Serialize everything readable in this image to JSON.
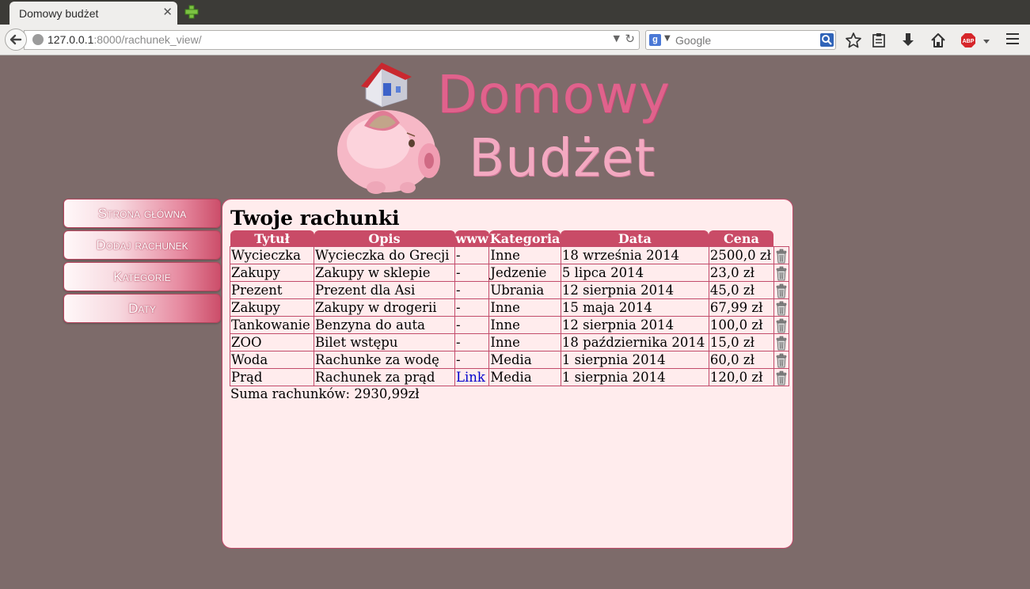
{
  "browser": {
    "tab_title": "Domowy budżet",
    "tab_close": "✕",
    "url_host": "127.0.0.1",
    "url_rest": ":8000/rachunek_view/",
    "search_placeholder": "Google",
    "search_engine_letter": "g"
  },
  "logo": {
    "line1": "Domowy",
    "line2": "Budżet"
  },
  "menu": [
    {
      "label": "Strona główna"
    },
    {
      "label": "Dodaj rachunek"
    },
    {
      "label": "Kategorie"
    },
    {
      "label": "Daty"
    }
  ],
  "content": {
    "heading": "Twoje rachunki",
    "headers": [
      "Tytuł",
      "Opis",
      "www",
      "Kategoria",
      "Data",
      "Cena"
    ],
    "rows": [
      {
        "title": "Wycieczka",
        "desc": "Wycieczka do Grecji",
        "www": "-",
        "category": "Inne",
        "date": "18 września 2014",
        "price": "2500,0 zł"
      },
      {
        "title": "Zakupy",
        "desc": "Zakupy w sklepie",
        "www": "-",
        "category": "Jedzenie",
        "date": "5 lipca 2014",
        "price": "23,0 zł"
      },
      {
        "title": "Prezent",
        "desc": "Prezent dla Asi",
        "www": "-",
        "category": "Ubrania",
        "date": "12 sierpnia 2014",
        "price": "45,0 zł"
      },
      {
        "title": "Zakupy",
        "desc": "Zakupy w drogerii",
        "www": "-",
        "category": "Inne",
        "date": "15 maja 2014",
        "price": "67,99 zł"
      },
      {
        "title": "Tankowanie",
        "desc": "Benzyna do auta",
        "www": "-",
        "category": "Inne",
        "date": "12 sierpnia 2014",
        "price": "100,0 zł"
      },
      {
        "title": "ZOO",
        "desc": "Bilet wstępu",
        "www": "-",
        "category": "Inne",
        "date": "18 października 2014",
        "price": "15,0 zł"
      },
      {
        "title": "Woda",
        "desc": "Rachunke za wodę",
        "www": "-",
        "category": "Media",
        "date": "1 sierpnia 2014",
        "price": "60,0 zł"
      },
      {
        "title": "Prąd",
        "desc": "Rachunek za prąd",
        "www": "Link",
        "category": "Media",
        "date": "1 sierpnia 2014",
        "price": "120,0 zł"
      }
    ],
    "total": "Suma rachunków: 2930,99zł"
  }
}
